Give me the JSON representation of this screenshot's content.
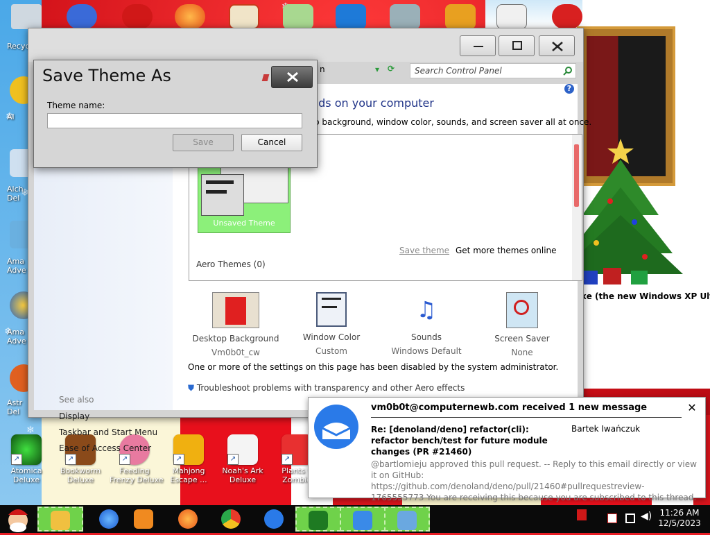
{
  "desktop": {
    "top_icons": [
      "recycle-bin",
      "app-shield",
      "puffle",
      "firefox",
      "gate",
      "frog",
      "arrow-r",
      "shark",
      "gem",
      "window",
      "mascot"
    ],
    "left_labels": [
      "Recycl",
      "Al",
      "Alch\nDel",
      "Ama\nAdve",
      "Ama\nAdve",
      "Astr\nDel"
    ],
    "partial_text": "xe (the new Windows XP Ulti",
    "bottom_icons": [
      {
        "label": "Atomica\nDeluxe",
        "icon": "atomica"
      },
      {
        "label": "Bookworm\nDeluxe",
        "icon": "bookworm"
      },
      {
        "label": "Feeding\nFrenzy Deluxe",
        "icon": "feeding-frenzy"
      },
      {
        "label": "Mahjong\nEscape ...",
        "icon": "mahjong"
      },
      {
        "label": "Noah's Ark\nDeluxe",
        "icon": "noahs-ark"
      },
      {
        "label": "Plants v\nZombie",
        "icon": "plants-vs-zombies"
      }
    ]
  },
  "control_panel": {
    "address_tail": "n",
    "search_placeholder": "Search Control Panel",
    "heading": "nds on your computer",
    "subtext": "p background, window color, sounds, and screen saver all at once.",
    "theme_tile_label": "Unsaved Theme",
    "save_theme": "Save theme",
    "get_more": "Get more themes online",
    "aero_themes": "Aero Themes (0)",
    "items": [
      {
        "title": "Desktop Background",
        "value": "Vm0b0t_cw",
        "icon": "desktop-background"
      },
      {
        "title": "Window Color",
        "value": "Custom",
        "icon": "window-color"
      },
      {
        "title": "Sounds",
        "value": "Windows Default",
        "icon": "sounds"
      },
      {
        "title": "Screen Saver",
        "value": "None",
        "icon": "screen-saver"
      }
    ],
    "disabled_msg": "One or more of the settings on this page has been disabled by the system administrator.",
    "troubleshoot": "Troubleshoot problems with transparency and other Aero effects",
    "see_also": "See also",
    "side_links": [
      "Display",
      "Taskbar and Start Menu",
      "Ease of Access Center"
    ]
  },
  "dialog": {
    "title": "Save Theme As",
    "field_label": "Theme name:",
    "field_value": "",
    "save_label": "Save",
    "cancel_label": "Cancel"
  },
  "notification": {
    "title": "vm0b0t@computernewb.com received 1 new message",
    "close": "✕",
    "subject": "Re: [denoland/deno] refactor(cli): refactor bench/test for future module changes (PR #21460)",
    "from": "Bartek Iwańczuk",
    "body": "@bartlomieju approved this pull request. -- Reply to this email directly or view it on GitHub: https://github.com/denoland/deno/pull/21460#pullrequestreview-1765555773 You are receiving this because you are subscribed to this thread. Mes"
  },
  "taskbar": {
    "buttons": [
      "explorer",
      "internet-explorer",
      "media-player",
      "firefox",
      "chrome",
      "arrow-up-app",
      "christmas-tree",
      "download",
      "control-panel"
    ],
    "time": "11:26 AM",
    "date": "12/5/2023"
  }
}
